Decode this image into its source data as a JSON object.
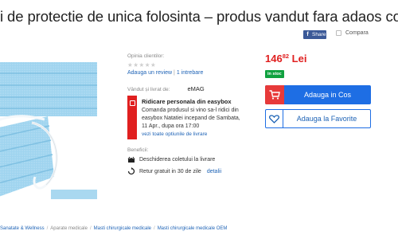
{
  "product": {
    "title": "i de protectie de unica folosinta – produs vandut fara adaos comercial"
  },
  "social": {
    "share_label": "Share",
    "share_icon": "f",
    "compare_label": "Compara"
  },
  "reviews": {
    "opinions_label": "Opinia clientilor:",
    "add_review": "Adauga un review",
    "separator": "|",
    "questions": "1 intrebare"
  },
  "seller": {
    "label": "Vândut și livrat de:",
    "name": "eMAG"
  },
  "easybox": {
    "title": "Ridicare personala din easybox",
    "line1": "Comanda produsul si vino sa-l ridici din",
    "line2": "easybox Natatiei incepand de Sambata,",
    "line3": "11 Apr., dupa ora 17:00",
    "link": "vezi toate optiunile de livrare"
  },
  "benefits": {
    "label": "Beneficii:",
    "item1": "Deschiderea coletului la livrare",
    "item2": "Retur gratuit in 30 de zile",
    "item2_link": "detalii"
  },
  "pricing": {
    "integer": "146",
    "decimals": "82",
    "currency": "Lei",
    "stock": "in stoc"
  },
  "actions": {
    "add_to_cart": "Adauga in Cos",
    "add_to_favorites": "Adauga la Favorite"
  },
  "breadcrumb": {
    "items": [
      "Sanatate & Wellness",
      "Aparate medicale",
      "Masti chirurgicale medicale",
      "Masti chirurgicale medicale OEM"
    ]
  },
  "colors": {
    "accent_blue": "#1e6ee4",
    "price_red": "#e02020",
    "stock_green": "#10a13f",
    "facebook_blue": "#3b5998"
  }
}
